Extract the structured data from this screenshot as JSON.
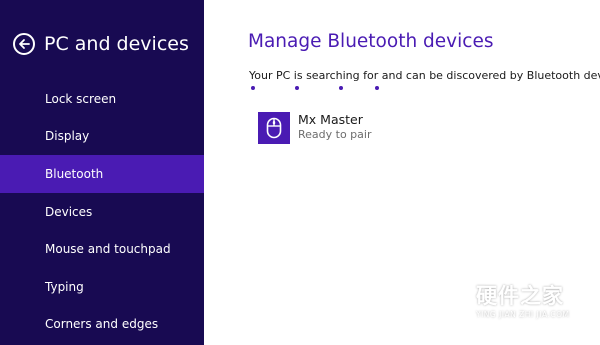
{
  "sidebar": {
    "back_icon": "back-arrow-circle-icon",
    "title": "PC and devices",
    "items": [
      {
        "label": "Lock screen",
        "active": false
      },
      {
        "label": "Display",
        "active": false
      },
      {
        "label": "Bluetooth",
        "active": true
      },
      {
        "label": "Devices",
        "active": false
      },
      {
        "label": "Mouse and touchpad",
        "active": false
      },
      {
        "label": "Typing",
        "active": false
      },
      {
        "label": "Corners and edges",
        "active": false
      }
    ]
  },
  "main": {
    "title": "Manage Bluetooth devices",
    "status": "Your PC is searching for and can be discovered by Bluetooth devices.",
    "progress_indicator": "searching-dots",
    "devices": [
      {
        "name": "Mx Master",
        "status": "Ready to pair",
        "icon": "mouse-icon"
      }
    ]
  },
  "watermark": {
    "main": "硬件之家",
    "sub": "YING JIAN ZHI JIA.COM"
  },
  "colors": {
    "sidebar_bg": "#180a52",
    "accent": "#4a1bb3",
    "text": "#1a1a1a",
    "subtext": "#6d6d6d"
  }
}
